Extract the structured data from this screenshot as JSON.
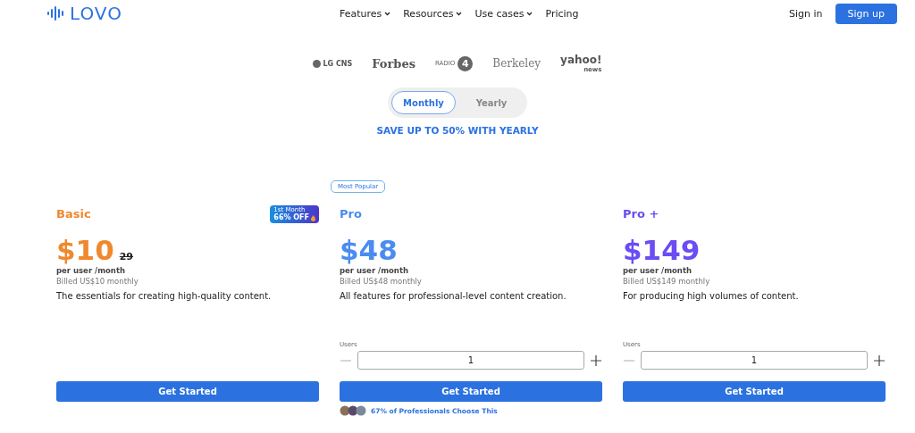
{
  "header": {
    "logo": "LOVO",
    "nav": [
      {
        "label": "Features",
        "dropdown": true
      },
      {
        "label": "Resources",
        "dropdown": true
      },
      {
        "label": "Use cases",
        "dropdown": true
      },
      {
        "label": "Pricing",
        "dropdown": false
      }
    ],
    "sign_in": "Sign in",
    "sign_up": "Sign up"
  },
  "logos": [
    {
      "kind": "lg",
      "text": "LG CNS"
    },
    {
      "kind": "forbes",
      "text": "Forbes"
    },
    {
      "kind": "bbc",
      "text": "RADIO",
      "number": "4"
    },
    {
      "kind": "berkeley",
      "text": "Berkeley"
    },
    {
      "kind": "yahoo",
      "text": "yahoo!",
      "sub": "news"
    }
  ],
  "billing_options": [
    {
      "label": "Monthly",
      "selected": true
    },
    {
      "label": "Yearly",
      "selected": false
    }
  ],
  "save_note": "SAVE UP TO 50% WITH YEARLY",
  "plans": [
    {
      "name": "Basic",
      "color": "#f0882e",
      "price": "$10",
      "old_price": "29",
      "offer": [
        "1st Month",
        "66% OFF"
      ],
      "unit": "per user /month",
      "billed": "Billed US$10 monthly",
      "description": "The essentials for creating high-quality content.",
      "button": "Get Started"
    },
    {
      "name": "Pro",
      "color": "#4a8cf0",
      "badge": "Most Popular",
      "price": "$48",
      "unit": "per user /month",
      "billed": "Billed US$48 monthly",
      "description": "All features for professional-level content creation.",
      "users": {
        "label": "Users",
        "value": "1"
      },
      "button": "Get Started",
      "social_proof": "67% of Professionals Choose This"
    },
    {
      "name": "Pro +",
      "color": "#6b4cf5",
      "price": "$149",
      "unit": "per user /month",
      "billed": "Billed US$149 monthly",
      "description": "For producing high volumes of content.",
      "users": {
        "label": "Users",
        "value": "1"
      },
      "button": "Get Started"
    }
  ]
}
